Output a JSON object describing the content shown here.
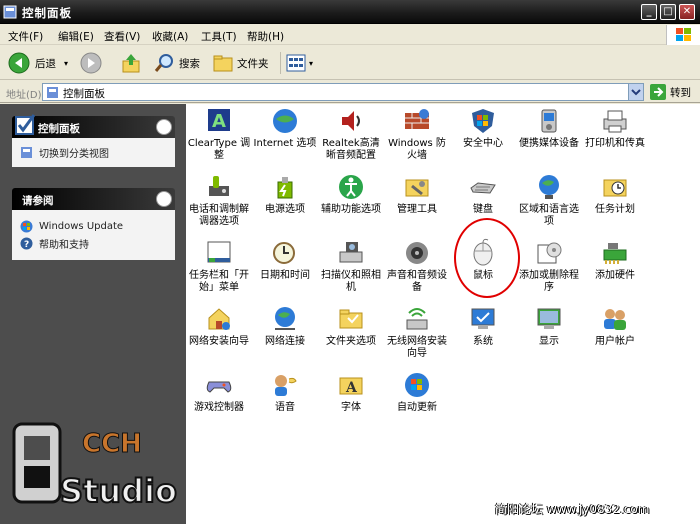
{
  "window": {
    "title": "控制面板"
  },
  "menu": [
    "文件(F)",
    "编辑(E)",
    "查看(V)",
    "收藏(A)",
    "工具(T)",
    "帮助(H)"
  ],
  "toolbar": {
    "back": "后退",
    "search": "搜索",
    "folders": "文件夹"
  },
  "address": {
    "label": "地址(D)",
    "value": "控制面板",
    "go": "转到"
  },
  "sidebar": {
    "panel1": {
      "title": "控制面板",
      "items": [
        "切换到分类视图"
      ]
    },
    "panel2": {
      "title": "请参阅",
      "items": [
        "Windows Update",
        "帮助和支持"
      ]
    }
  },
  "icons": [
    {
      "label": "ClearType 调整",
      "icon": "cleartype-icon"
    },
    {
      "label": "Internet 选项",
      "icon": "internet-options-icon"
    },
    {
      "label": "Realtek高清晰音频配置",
      "icon": "realtek-audio-icon"
    },
    {
      "label": "Windows 防火墙",
      "icon": "firewall-icon"
    },
    {
      "label": "安全中心",
      "icon": "security-center-icon"
    },
    {
      "label": "便携媒体设备",
      "icon": "portable-media-icon"
    },
    {
      "label": "打印机和传真",
      "icon": "printer-icon"
    },
    {
      "label": "电话和调制解调器选项",
      "icon": "phone-modem-icon"
    },
    {
      "label": "电源选项",
      "icon": "power-options-icon"
    },
    {
      "label": "辅助功能选项",
      "icon": "accessibility-icon"
    },
    {
      "label": "管理工具",
      "icon": "admin-tools-icon"
    },
    {
      "label": "键盘",
      "icon": "keyboard-icon"
    },
    {
      "label": "区域和语言选项",
      "icon": "region-language-icon"
    },
    {
      "label": "任务计划",
      "icon": "scheduled-tasks-icon"
    },
    {
      "label": "任务栏和「开始」菜单",
      "icon": "taskbar-icon"
    },
    {
      "label": "日期和时间",
      "icon": "date-time-icon"
    },
    {
      "label": "扫描仪和照相机",
      "icon": "scanner-camera-icon"
    },
    {
      "label": "声音和音频设备",
      "icon": "sound-icon"
    },
    {
      "label": "鼠标",
      "icon": "mouse-icon"
    },
    {
      "label": "添加或删除程序",
      "icon": "add-remove-programs-icon"
    },
    {
      "label": "添加硬件",
      "icon": "add-hardware-icon"
    },
    {
      "label": "网络安装向导",
      "icon": "network-setup-icon"
    },
    {
      "label": "网络连接",
      "icon": "network-connections-icon"
    },
    {
      "label": "文件夹选项",
      "icon": "folder-options-icon"
    },
    {
      "label": "无线网络安装向导",
      "icon": "wireless-setup-icon"
    },
    {
      "label": "系统",
      "icon": "system-icon"
    },
    {
      "label": "显示",
      "icon": "display-icon"
    },
    {
      "label": "用户帐户",
      "icon": "user-accounts-icon"
    },
    {
      "label": "游戏控制器",
      "icon": "game-controllers-icon"
    },
    {
      "label": "语音",
      "icon": "speech-icon"
    },
    {
      "label": "字体",
      "icon": "fonts-icon"
    },
    {
      "label": "自动更新",
      "icon": "automatic-updates-icon"
    }
  ],
  "logo": {
    "top": "CCH",
    "bottom": "Studio"
  },
  "watermark": "简阳论坛 www.jy0832.com"
}
